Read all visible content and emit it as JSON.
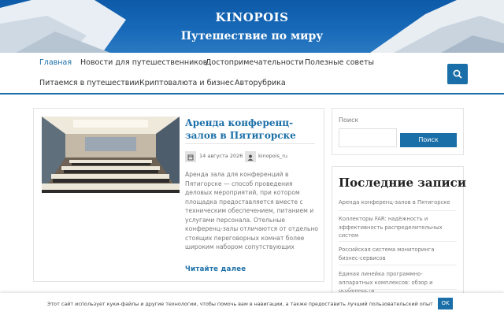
{
  "header": {
    "site_title": "KINOPOIS",
    "site_description": "Путешествие по миру"
  },
  "nav": {
    "items": [
      {
        "label": "Главная",
        "active": true
      },
      {
        "label": "Новости для путешественников"
      },
      {
        "label": "Достопримечательности"
      },
      {
        "label": "Полезные советы"
      },
      {
        "label": "Питаемся в путешествии"
      },
      {
        "label": "Криптовалюта и бизнес"
      },
      {
        "label": "Авторубрика"
      }
    ],
    "search_icon": "search-icon"
  },
  "post": {
    "title": "Аренда конференц-залов в Пятигорске",
    "date": "14 августа 2026",
    "date_icon": "calendar-icon",
    "author": "kinopois_ru",
    "author_icon": "user-icon",
    "excerpt": "Аренда зала для конференций в Пятигорске — способ проведения деловых мероприятий, при котором площадка предоставляется вместе с техническим обеспечением, питанием и услугами персонала. Отельные конференц-залы отличаются от отдельно стоящих переговорных комнат более широким набором сопутствующих",
    "read_more": "Читайте далее"
  },
  "sidebar": {
    "search": {
      "label": "Поиск",
      "button": "Поиск",
      "placeholder": ""
    },
    "recent": {
      "title": "Последние записи",
      "items": [
        "Аренда конференц-залов в Пятигорске",
        "Коллекторы FAR: надёжность и эффективность распределительных систем",
        "Российская система мониторинга бизнес-сервисов",
        "Единая линейка программно-аппаратных комплексов: обзор и особенности"
      ]
    }
  },
  "cookie": {
    "text": "Этот сайт использует куки-файлы и другие технологии, чтобы помочь вам в навигации, а также предоставить лучший пользовательский опыт",
    "ok": "OK"
  },
  "colors": {
    "accent": "#1b6fa8",
    "header_sky": "#1769b8"
  }
}
